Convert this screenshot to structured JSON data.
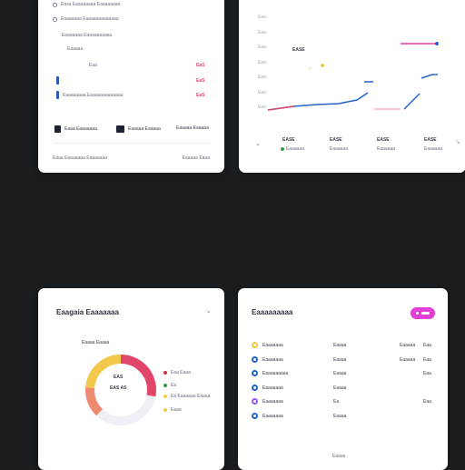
{
  "colors": {
    "background": "#1a1d1f",
    "accent_pink": "#e0466a",
    "accent_blue": "#2563c9",
    "donut_yellow": "#f2c94c",
    "donut_orange": "#ee8a6f",
    "pill_magenta": "#e23fd6"
  },
  "top_left": {
    "rows": [
      {
        "label": "Easa Eaaaaaaaa Eaaaaaaaa",
        "icon": "circle-outline-icon"
      },
      {
        "label": "Eaaaaaaa Eaaaaaaaaaaaaa",
        "icon": "circle-outline-icon"
      }
    ],
    "sub_label": "Eaaaaaaa Eaaaaaaaaaa",
    "small_label": "Eaaaaa",
    "tiny_label": "Eaa",
    "value_a": "EaS",
    "blue_row_label": "Eaaaaaaaa Eaaaaaaaaaaaaa",
    "value_b": "EaS",
    "value_c": "EaS",
    "footer_items": [
      {
        "icon": "document-icon",
        "label": "Eaaa Eaaaaaaa"
      },
      {
        "icon": "columns-icon",
        "label": "Eaaaaa Eaaaaa"
      },
      {
        "icon": "",
        "label": "Eaaaaa Eaaaaa"
      }
    ],
    "bottom_left": "Eaaa Eaaaaaaa Eaaaaaaa",
    "bottom_right": "Eaaaaa Eaaa"
  },
  "top_right": {
    "y_ticks": [
      "Eaa",
      "Eaa",
      "Eaa",
      "Eaa",
      "Eaa",
      "Eaa",
      "Eaa"
    ],
    "annotation": "EASE",
    "stats": [
      {
        "value": "EASE",
        "label": "Eaaaaaa",
        "dot": true
      },
      {
        "value": "EASE",
        "label": "Eaaaaaa",
        "dot": false
      },
      {
        "value": "EASE",
        "label": "Eaaaaaa",
        "dot": false
      },
      {
        "value": "EASE",
        "label": "Eaaaaaa",
        "dot": false
      }
    ]
  },
  "bottom_left": {
    "title": "Eaagaia Eaaaaaaa",
    "donut_label": "Eaaaa Eaaaa",
    "center_line1": "EAS",
    "center_line2": "EAS AS",
    "legend": [
      {
        "label": "Eaa Eaaa",
        "color": "#c8334d"
      },
      {
        "label": "Ea",
        "color": "#2f9e4c"
      },
      {
        "label": "Ea Eaaaaaa Eaaaa",
        "color": "#f2c94c"
      },
      {
        "label": "Eaaa",
        "color": "#f2c94c"
      }
    ],
    "donut": [
      {
        "label": "pink",
        "value": 0.28,
        "color": "#e0466a"
      },
      {
        "label": "light",
        "value": 0.34,
        "color": "#eef0f5"
      },
      {
        "label": "orange",
        "value": 0.14,
        "color": "#ee8a6f"
      },
      {
        "label": "yellow",
        "value": 0.24,
        "color": "#f2c94c"
      }
    ]
  },
  "bottom_right": {
    "title": "Eaaaaaaaaa",
    "rows": [
      {
        "icon_color": "#f2c94c",
        "name": "Eaaaaaaa",
        "mid": "Eaaaa",
        "right": "Eaaaaa",
        "far": "Eaa"
      },
      {
        "icon_color": "#2563c9",
        "name": "Eaaaaaaa",
        "mid": "Eaaaa",
        "right": "Eaaaaa",
        "far": "Eaa"
      },
      {
        "icon_color": "#2563c9",
        "name": "Eaaaaaaaaa",
        "mid": "Eaaaa",
        "right": "",
        "far": "Eaa"
      },
      {
        "icon_color": "#2563c9",
        "name": "Eaaaaaaa",
        "mid": "Eaaaa",
        "right": "",
        "far": ""
      },
      {
        "icon_color": "#8b5cf6",
        "name": "Eaaaaaaa",
        "mid": "Ea",
        "right": "",
        "far": "Eaa"
      },
      {
        "icon_color": "#2563c9",
        "name": "Eaaaaaaa",
        "mid": "Eaaaa",
        "right": "",
        "far": ""
      }
    ],
    "footer": "Eaaaa"
  }
}
